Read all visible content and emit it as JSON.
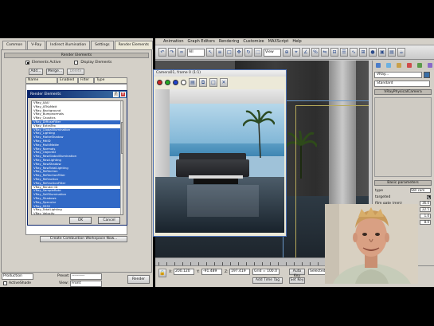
{
  "max_window": {
    "menu": [
      "Animation",
      "Graph Editors",
      "Rendering",
      "Customize",
      "MAXScript",
      "Help"
    ],
    "toolbar": {
      "selection_filter": "All",
      "ref_coord": "View"
    },
    "command_panel": {
      "object_name": "VRay...",
      "dropdown": "Standard",
      "rollout_top": "VRayPhysicalCamera",
      "rollout_params": "Basic parameters",
      "params": [
        {
          "label": "type",
          "value": "Still cam"
        },
        {
          "label": "targeted",
          "value": ""
        },
        {
          "label": "film gate (mm)",
          "value": "36.0"
        },
        {
          "label": "focal length (mm)",
          "value": "22.5"
        },
        {
          "label": "zoom factor",
          "value": "1.0"
        },
        {
          "label": "f-number",
          "value": "8.0"
        }
      ]
    },
    "status": {
      "x": "200.120",
      "y": "-91.489",
      "z": "197.419",
      "grid": "Grid = 100.0",
      "time_tag": "Add Time Tag",
      "key_mode": "Auto Key",
      "set_key": "Set Key",
      "selected": "Selected"
    }
  },
  "render_frame": {
    "title": "Camera01, frame 0 (1:1)",
    "chip_colors": [
      "#cc2222",
      "#22aa22",
      "#2244cc",
      "#ffffff"
    ]
  },
  "left_panel": {
    "tabs": [
      "Common",
      "V-Ray",
      "Indirect illumination",
      "Settings",
      "Render Elements"
    ],
    "active_tab": 4,
    "rollout": "Render Elements",
    "elements_active_label": "Elements Active",
    "display_elements_label": "Display Elements",
    "add_label": "Add...",
    "merge_label": "Merge...",
    "delete_label": "Delete",
    "col_name": "Name",
    "col_enabled": "Enabled",
    "col_filter": "Filter",
    "col_type": "Type",
    "create_composite": "Create Combustion Workspace Now...",
    "preset_label": "Preset:",
    "preset_value": "----------",
    "view_label": "View:",
    "view_value": "Front",
    "production_label": "Production",
    "activeshade_label": "ActiveShade",
    "render_button": "Render"
  },
  "modal": {
    "title": "Render Elements",
    "items": [
      {
        "label": "VRay_AAU",
        "sel": false
      },
      {
        "label": "VRay_ATKoMatt",
        "sel": false
      },
      {
        "label": "VRay_Background",
        "sel": false
      },
      {
        "label": "VRay_Bumpnormals",
        "sel": false
      },
      {
        "label": "VRay_Caustics",
        "sel": false
      },
      {
        "label": "VRay_DiffuseFilter",
        "sel": true
      },
      {
        "label": "VRay_ExtraTex",
        "sel": false
      },
      {
        "label": "VRay_GlobalIllumination",
        "sel": true
      },
      {
        "label": "VRay_Lighting",
        "sel": true
      },
      {
        "label": "VRay_MatteShadow",
        "sel": true
      },
      {
        "label": "VRay_MtlID",
        "sel": true
      },
      {
        "label": "VRay_MultiMatte",
        "sel": true
      },
      {
        "label": "VRay_Normals",
        "sel": true
      },
      {
        "label": "VRay_ObjectID",
        "sel": true
      },
      {
        "label": "VRay_RawGlobalIllumination",
        "sel": true
      },
      {
        "label": "VRay_RawLighting",
        "sel": true
      },
      {
        "label": "VRay_RawShadow",
        "sel": true
      },
      {
        "label": "VRay_RawTotalLighting",
        "sel": true
      },
      {
        "label": "VRay_Reflection",
        "sel": true
      },
      {
        "label": "VRay_ReflectionFilter",
        "sel": true
      },
      {
        "label": "VRay_Refraction",
        "sel": true
      },
      {
        "label": "VRay_RefractionFilter",
        "sel": true
      },
      {
        "label": "VRay_Render ID",
        "sel": false
      },
      {
        "label": "VRay_SampleRate",
        "sel": true
      },
      {
        "label": "VRay_SelfIllumination",
        "sel": true
      },
      {
        "label": "VRay_Shadows",
        "sel": true
      },
      {
        "label": "VRay_Specular",
        "sel": true
      },
      {
        "label": "VRay_SSS2",
        "sel": true
      },
      {
        "label": "VRay_TotalLighting",
        "sel": false
      },
      {
        "label": "VRay_Velocity",
        "sel": false
      },
      {
        "label": "VRay_WireColor",
        "sel": true
      },
      {
        "label": "VRay_ZDepth",
        "sel": true
      }
    ],
    "ok_label": "OK",
    "cancel_label": "Cancel"
  },
  "colors": {
    "selection": "#3169c6",
    "titlebar": "#0a246a",
    "panel": "#d4d0c8"
  }
}
